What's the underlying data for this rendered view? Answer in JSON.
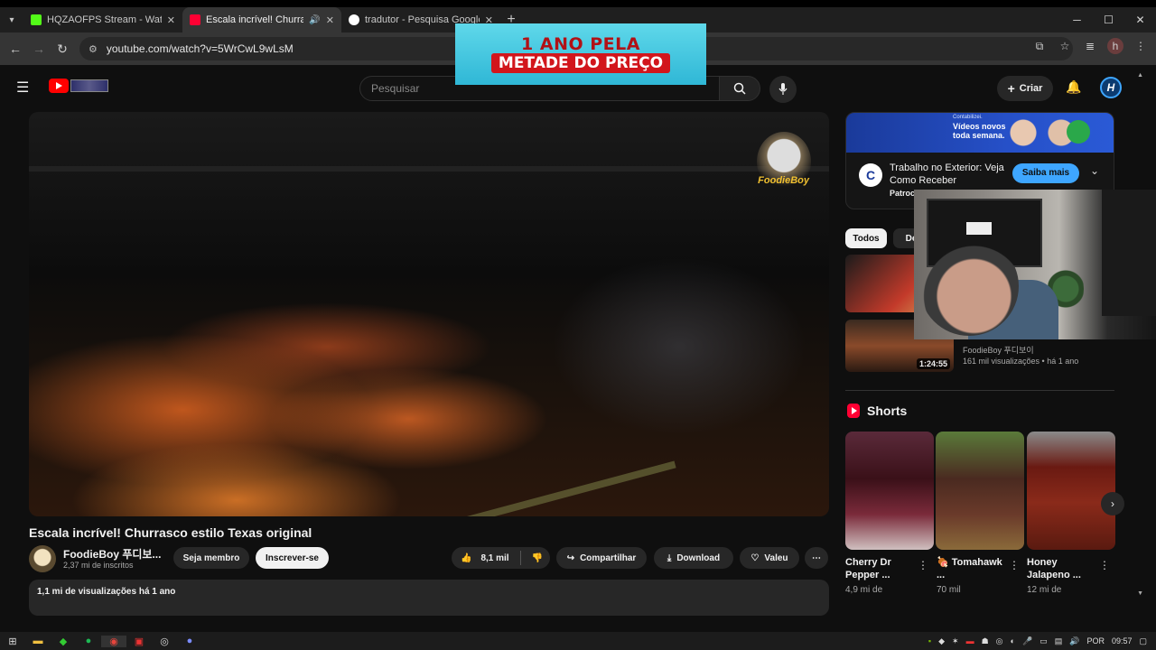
{
  "browser": {
    "tabs": [
      {
        "title": "HQZAOFPS Stream - Watch Liv",
        "favicon_color": "#53fc18"
      },
      {
        "title": "Escala incrível! Churrasco e",
        "favicon_color": "#ff0033",
        "audio_icon": "speaker-icon"
      },
      {
        "title": "tradutor - Pesquisa Google",
        "favicon_color": "#ffffff"
      }
    ],
    "url": "youtube.com/watch?v=5WrCwL9wLsM",
    "profile_initial": "h",
    "window_controls": [
      "─",
      "☐",
      "✕"
    ]
  },
  "promo": {
    "line1": "1 ANO PELA",
    "line2": "METADE DO PREÇO"
  },
  "youtube": {
    "search_placeholder": "Pesquisar",
    "create_label": "Criar",
    "avatar_initial": "H"
  },
  "player": {
    "brand": "FoodieBoy"
  },
  "video": {
    "title": "Escala incrível! Churrasco estilo Texas original",
    "channel_name": "FoodieBoy 푸디보...",
    "subscribers": "2,37 mi de inscritos",
    "join_label": "Seja membro",
    "subscribe_label": "Inscrever-se",
    "likes": "8,1 mil",
    "share_label": "Compartilhar",
    "download_label": "Download",
    "thanks_label": "Valeu",
    "description_meta": "1,1 mi de visualizações  há 1 ano"
  },
  "ad": {
    "banner_text": "Vídeos novos toda semana.",
    "banner_brand": "Contabilizei.",
    "title": "Trabalho no Exterior: Veja Como Receber",
    "sponsor": "Patrocinado",
    "button_label": "Saiba mais"
  },
  "chips": [
    {
      "label": "Todos",
      "active": true
    },
    {
      "label": "De",
      "active": false
    }
  ],
  "recommendations": [
    {
      "channel": "FoodieBoy 푸디보이",
      "views": "161 mil visualizações • há 1 ano",
      "duration": "1:24:55"
    }
  ],
  "shorts": {
    "heading": "Shorts",
    "items": [
      {
        "title": "Cherry Dr Pepper ...",
        "views": "4,9 mi de"
      },
      {
        "title": "🍖 Tomahawk ...",
        "views": "70 mil"
      },
      {
        "title": "Honey Jalapeno ...",
        "views": "12 mi de"
      }
    ]
  },
  "taskbar": {
    "language": "POR",
    "time": "09:57"
  }
}
